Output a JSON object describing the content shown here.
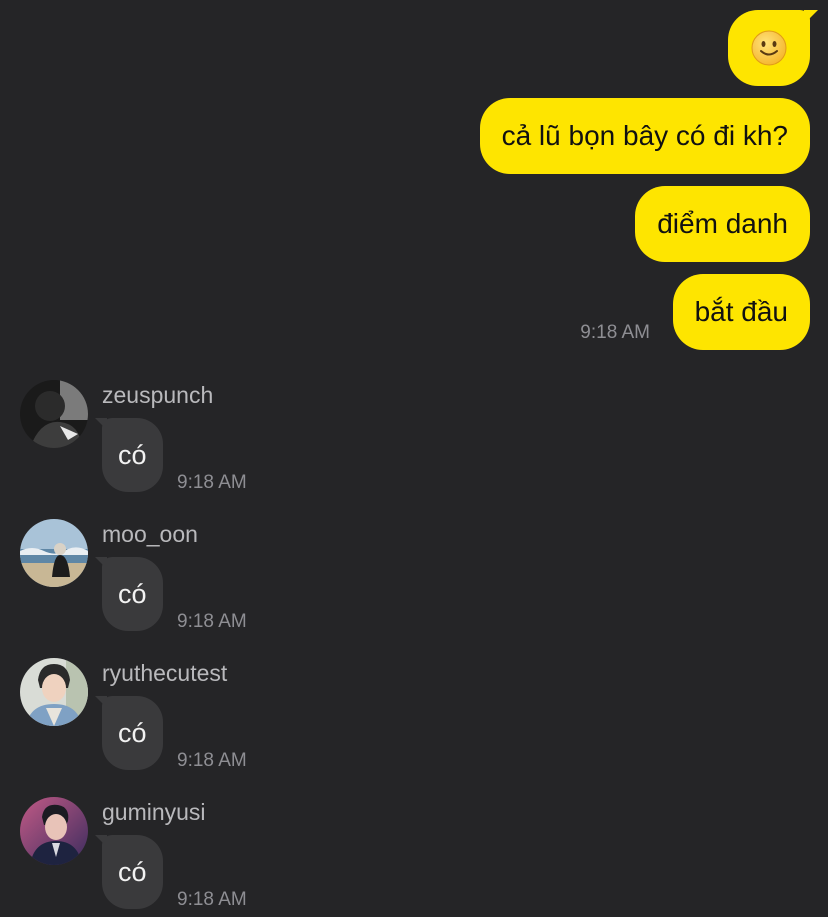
{
  "outgoing": {
    "emoji": "smiley-face-emoji",
    "messages": [
      "cả lũ bọn bây có đi kh?",
      "điểm danh",
      "bắt đầu"
    ],
    "time": "9:18 AM"
  },
  "incoming": [
    {
      "username": "zeuspunch",
      "text": "có",
      "time": "9:18 AM"
    },
    {
      "username": "moo_oon",
      "text": "có",
      "time": "9:18 AM"
    },
    {
      "username": "ryuthecutest",
      "text": "có",
      "time": "9:18 AM"
    },
    {
      "username": "guminyusi",
      "text": "có",
      "time": "9:18 AM"
    }
  ],
  "colors": {
    "background": "#252527",
    "outgoing_bubble": "#FEE500",
    "incoming_bubble": "#3A3A3C",
    "timestamp": "#8E8E93",
    "username": "#B9B9BC"
  }
}
